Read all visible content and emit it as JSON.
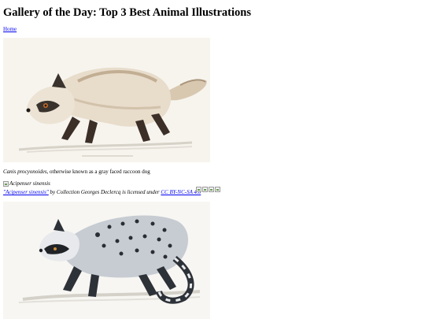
{
  "page": {
    "title": "Gallery of the Day: Top 3 Best Animal Illustrations",
    "home_link": "Home"
  },
  "items": [
    {
      "image_subject": "raccoon dog illustration",
      "caption_italic": "Canis procyonoides",
      "caption_rest": ", otherwise known as a gray faced raccoon dog"
    },
    {
      "broken_image_alt": "Acipenser sinensis",
      "credit_title": "\"Acipenser sinensis\"",
      "credit_by": " by Collection Georges Declercq is licensed under ",
      "license": "CC BY-NC-SA 4.0",
      "license_badges": [
        "cc-icon",
        "by-icon",
        "nc-icon",
        "sa-icon"
      ]
    },
    {
      "image_subject": "civet illustration"
    }
  ],
  "colors": {
    "link": "#0000ee",
    "text": "#000000",
    "background": "#ffffff"
  }
}
